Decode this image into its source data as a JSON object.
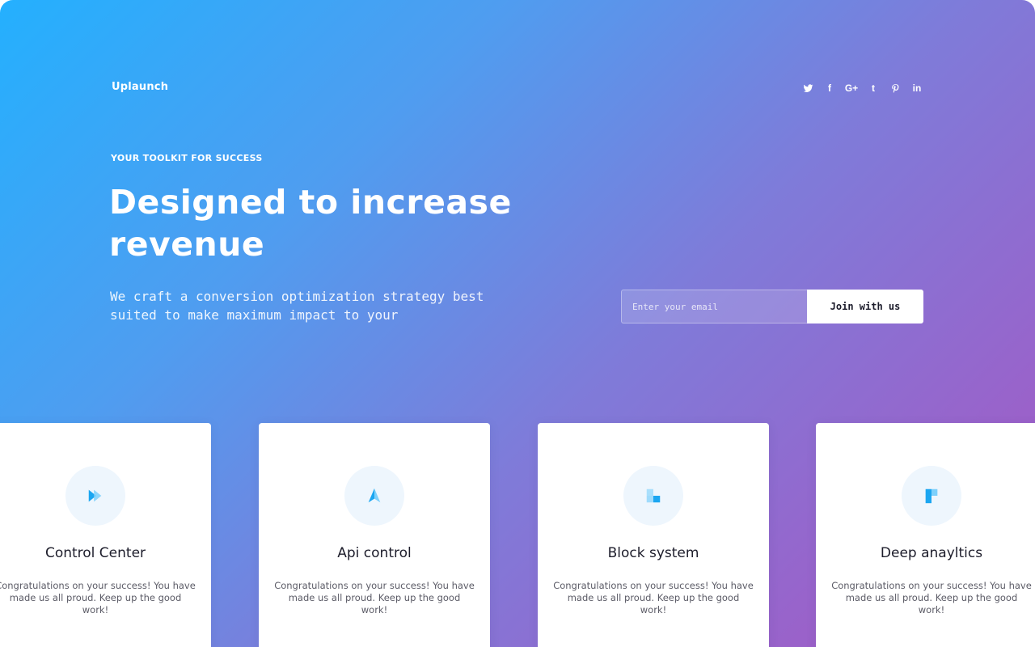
{
  "header": {
    "logo": "Uplaunch",
    "social": [
      {
        "icon": "twitter-icon"
      },
      {
        "icon": "facebook-icon",
        "text": "f"
      },
      {
        "icon": "google-plus-icon",
        "text": "G+"
      },
      {
        "icon": "tumblr-icon",
        "text": "t"
      },
      {
        "icon": "pinterest-icon"
      },
      {
        "icon": "linkedin-icon",
        "text": "in"
      }
    ]
  },
  "hero": {
    "eyebrow": "YOUR TOOLKIT FOR SUCCESS",
    "headline": "Designed to increase revenue",
    "subtext": "We craft a conversion optimization strategy best suited to make maximum impact to your"
  },
  "signup": {
    "email_placeholder": "Enter your email",
    "button_label": "Join with us"
  },
  "features": [
    {
      "icon": "fast-forward-icon",
      "title": "Control Center",
      "text": "Congratulations on your success! You have made us all proud. Keep up the good work!"
    },
    {
      "icon": "navigation-arrow-icon",
      "title": "Api control",
      "text": "Congratulations on your success! You have made us all proud. Keep up the good work!"
    },
    {
      "icon": "blocks-icon",
      "title": "Block system",
      "text": "Congratulations on your success! You have made us all proud. Keep up the good work!"
    },
    {
      "icon": "flag-icon",
      "title": "Deep anayltics",
      "text": "Congratulations on your success! You have made us all proud. Keep up the good work!"
    }
  ],
  "colors": {
    "gradient_start": "#24b0fe",
    "gradient_end": "#a855c2",
    "icon_blue": "#1ba6f1",
    "icon_light_blue": "#7dd0fb",
    "icon_circle_bg": "#eef6fd"
  }
}
